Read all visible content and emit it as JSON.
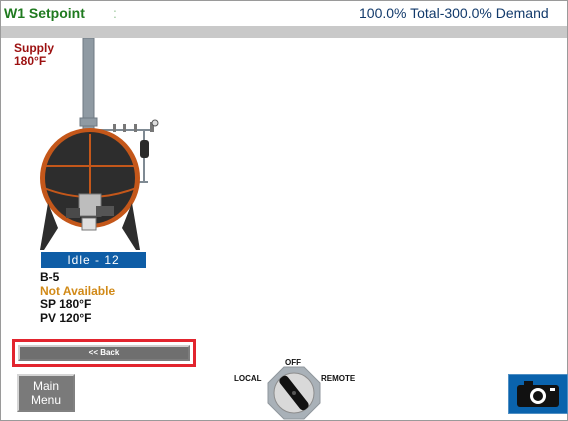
{
  "header": {
    "title": "W1 Setpoint",
    "separator": ":",
    "status": "100.0% Total-300.0% Demand"
  },
  "supply": {
    "label": "Supply",
    "temp": "180°F"
  },
  "boiler": {
    "state": "Idle - 12",
    "name": "B-5",
    "availability": "Not Available",
    "sp": "SP 180°F",
    "pv": "PV 120°F"
  },
  "buttons": {
    "back": "<< Back",
    "main_menu_line1": "Main",
    "main_menu_line2": "Menu"
  },
  "selector": {
    "off": "OFF",
    "local": "LOCAL",
    "remote": "REMOTE"
  },
  "icons": {
    "camera": "camera-icon",
    "boiler": "boiler-icon",
    "selector": "selector-switch-icon"
  },
  "colors": {
    "idle_banner": "#0e5da6",
    "not_available": "#d18a18",
    "supply_text": "#9c1010",
    "highlight": "#e2242e"
  }
}
